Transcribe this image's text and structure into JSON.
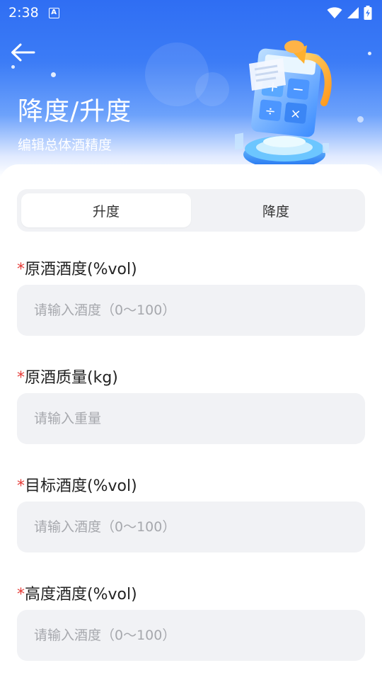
{
  "status_bar": {
    "time": "2:38",
    "notification_icon_letter": "A"
  },
  "header": {
    "title": "降度/升度",
    "subtitle": "编辑总体酒精度",
    "accent_color": "#2f6ef3"
  },
  "tabs": [
    {
      "label": "升度",
      "active": true
    },
    {
      "label": "降度",
      "active": false
    }
  ],
  "form": {
    "fields": [
      {
        "required_mark": "*",
        "label": "原酒酒度(%vol)",
        "placeholder": "请输入酒度（0～100）"
      },
      {
        "required_mark": "*",
        "label": "原酒质量(kg)",
        "placeholder": "请输入重量"
      },
      {
        "required_mark": "*",
        "label": "目标酒度(%vol)",
        "placeholder": "请输入酒度（0～100）"
      },
      {
        "required_mark": "*",
        "label": "高度酒度(%vol)",
        "placeholder": "请输入酒度（0～100）"
      }
    ]
  },
  "icons": {
    "back": "arrow-left-icon",
    "wifi": "wifi-icon",
    "signal": "cellular-signal-icon",
    "battery": "battery-charging-icon",
    "illustration": "calculator-illustration"
  }
}
